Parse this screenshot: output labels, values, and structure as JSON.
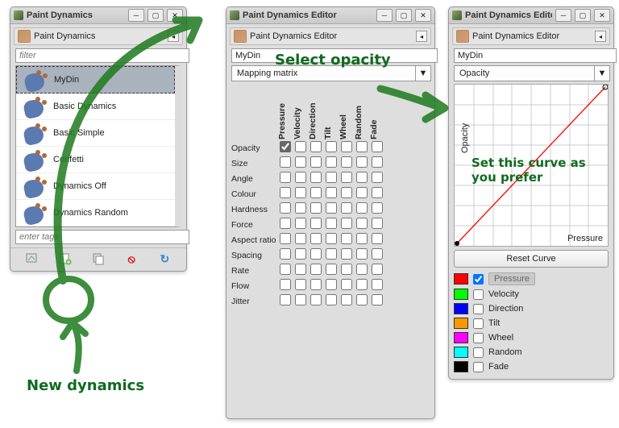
{
  "win1": {
    "title": "Paint Dynamics",
    "dock_title": "Paint Dynamics",
    "filter_placeholder": "filter",
    "tags_placeholder": "enter tags",
    "items": [
      {
        "label": "MyDin",
        "selected": true
      },
      {
        "label": "Basic Dynamics",
        "selected": false
      },
      {
        "label": "Basic Simple",
        "selected": false
      },
      {
        "label": "Confetti",
        "selected": false
      },
      {
        "label": "Dynamics Off",
        "selected": false
      },
      {
        "label": "Dynamics Random",
        "selected": false
      }
    ]
  },
  "win2": {
    "title": "Paint Dynamics Editor",
    "dock_title": "Paint Dynamics Editor",
    "name_value": "MyDin",
    "dropdown": "Mapping matrix",
    "columns": [
      "Pressure",
      "Velocity",
      "Direction",
      "Tilt",
      "Wheel",
      "Random",
      "Fade"
    ],
    "rows": [
      "Opacity",
      "Size",
      "Angle",
      "Colour",
      "Hardness",
      "Force",
      "Aspect ratio",
      "Spacing",
      "Rate",
      "Flow",
      "Jitter"
    ],
    "checked": {
      "row": "Opacity",
      "col": "Pressure"
    }
  },
  "win3": {
    "title": "Paint Dynamics Editor",
    "dock_title": "Paint Dynamics Editor",
    "name_value": "MyDin",
    "dropdown": "Opacity",
    "y_axis": "Opacity",
    "x_axis": "Pressure",
    "reset_label": "Reset Curve",
    "legend": [
      {
        "label": "Pressure",
        "color": "#ff0000",
        "checked": true,
        "hi": true
      },
      {
        "label": "Velocity",
        "color": "#00ff00",
        "checked": false
      },
      {
        "label": "Direction",
        "color": "#0000ff",
        "checked": false
      },
      {
        "label": "Tilt",
        "color": "#ff9900",
        "checked": false
      },
      {
        "label": "Wheel",
        "color": "#ff00ff",
        "checked": false
      },
      {
        "label": "Random",
        "color": "#00ffff",
        "checked": false
      },
      {
        "label": "Fade",
        "color": "#000000",
        "checked": false
      }
    ]
  },
  "ann": {
    "select_opacity": "Select opacity",
    "set_curve_l1": "Set this curve as",
    "set_curve_l2": "you prefer",
    "new_dynamics": "New dynamics"
  }
}
